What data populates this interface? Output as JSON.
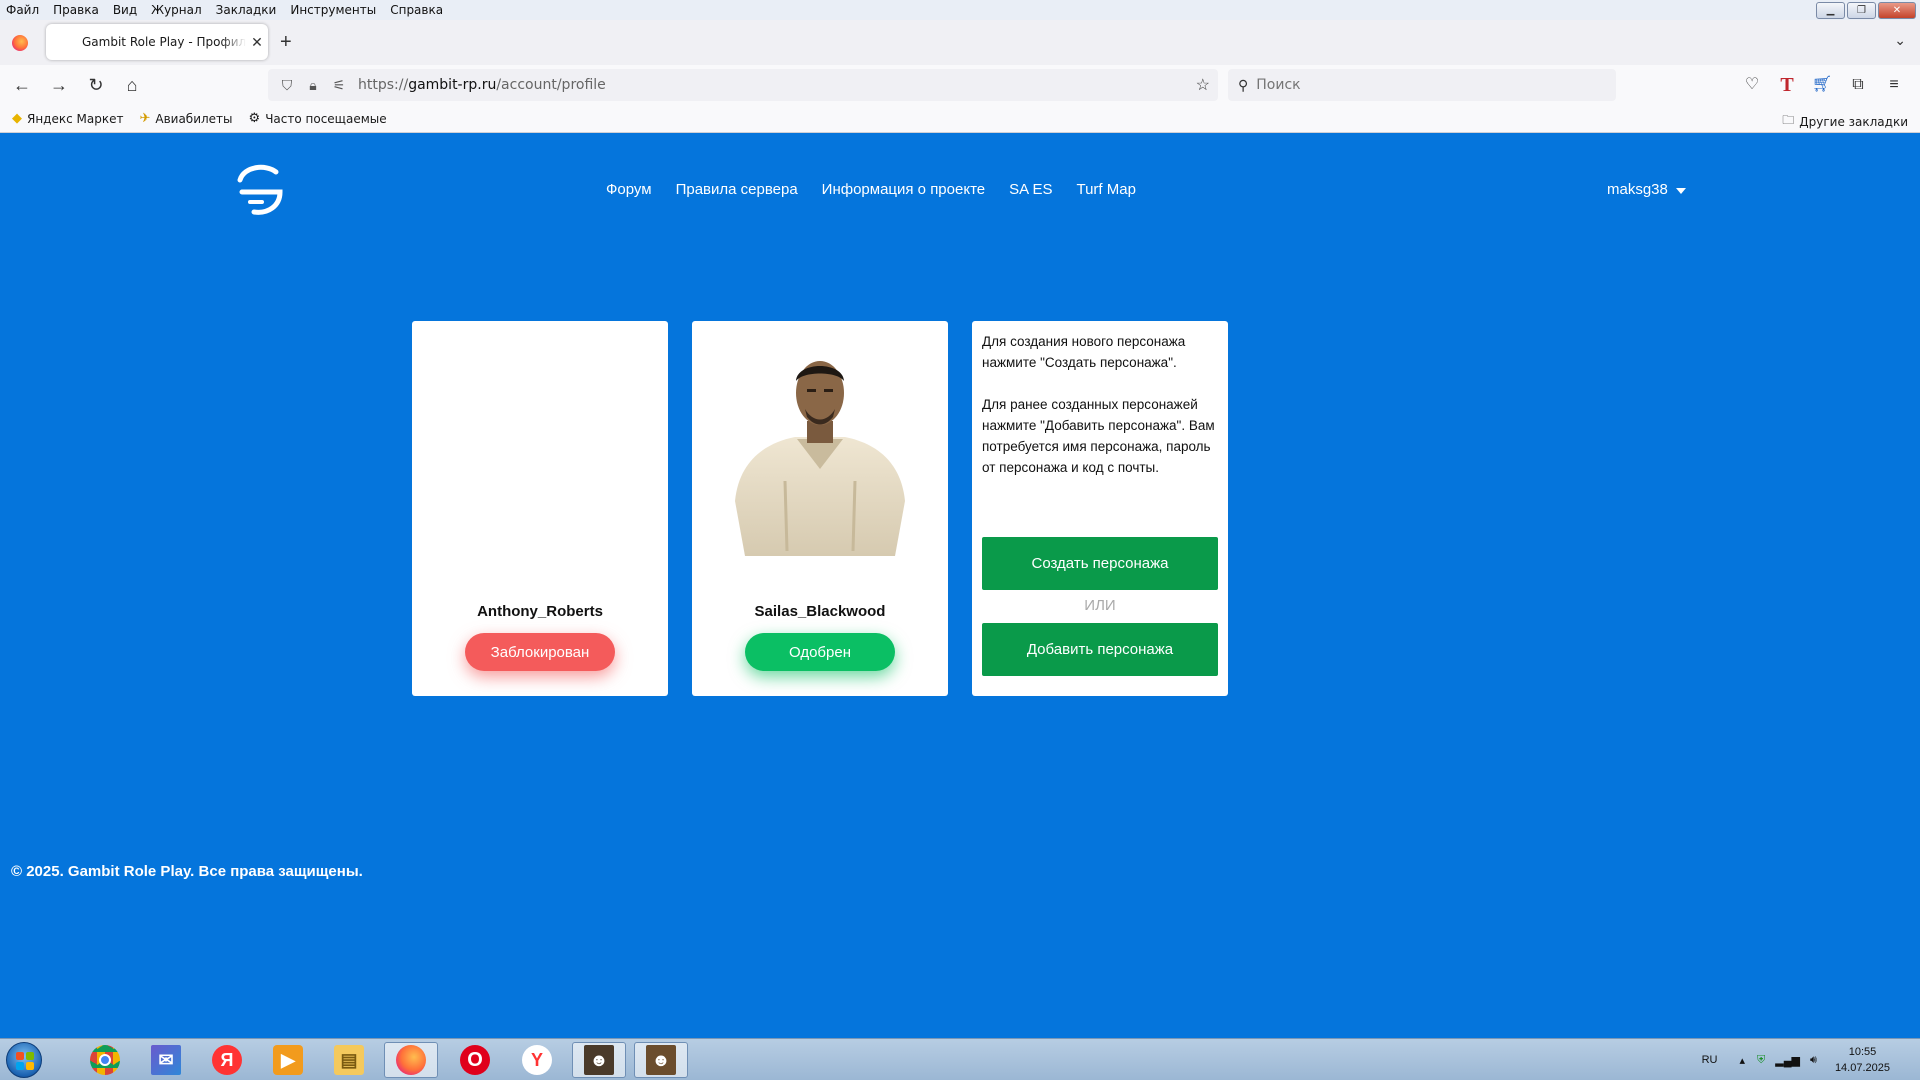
{
  "menubar": {
    "items": [
      "Файл",
      "Правка",
      "Вид",
      "Журнал",
      "Закладки",
      "Инструменты",
      "Справка"
    ]
  },
  "tab": {
    "title": "Gambit Role Play - Профиль UCP"
  },
  "urlbar": {
    "url_prefix": "https://",
    "url_domain": "gambit-rp.ru",
    "url_path": "/account/profile"
  },
  "search": {
    "placeholder": "Поиск"
  },
  "bookmarks": {
    "items": [
      "Яндекс Маркет",
      "Авиабилеты",
      "Часто посещаемые"
    ],
    "other": "Другие закладки"
  },
  "site": {
    "nav": [
      "Форум",
      "Правила сервера",
      "Информация о проекте",
      "SA ES",
      "Turf Map"
    ],
    "user": "maksg38"
  },
  "characters": [
    {
      "name": "Anthony_Roberts",
      "status": "Заблокирован",
      "status_color": "#f45b5b"
    },
    {
      "name": "Sailas_Blackwood",
      "status": "Одобрен",
      "status_color": "#0bbf64"
    }
  ],
  "create_card": {
    "text1": "Для создания нового персонажа нажмите \"Создать персонажа\".",
    "text2": "Для ранее созданных персонажей нажмите \"Добавить персонажа\". Вам потребуется имя персонажа, пароль от персонажа и код с почты.",
    "create_button": "Создать персонажа",
    "or": "ИЛИ",
    "add_button": "Добавить персонажа"
  },
  "footer": {
    "text": "© 2025. Gambit Role Play. Все права защищены."
  },
  "taskbar": {
    "lang": "RU",
    "time": "10:55",
    "date": "14.07.2025"
  },
  "colors": {
    "page_bg": "#0575dc",
    "button_green": "#0a9a4a"
  }
}
